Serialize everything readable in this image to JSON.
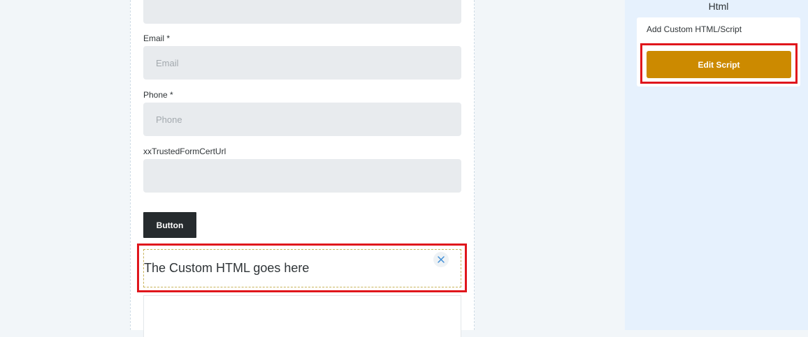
{
  "form": {
    "email_label": "Email *",
    "email_placeholder": "Email",
    "phone_label": "Phone *",
    "phone_placeholder": "Phone",
    "trusted_label": "xxTrustedFormCertUrl",
    "trusted_placeholder": "",
    "button_label": "Button",
    "custom_html_text": "The Custom HTML goes here"
  },
  "panel": {
    "title": "Html",
    "card_label": "Add Custom HTML/Script",
    "edit_button_label": "Edit Script"
  },
  "colors": {
    "highlight": "#e0161c",
    "edit_button": "#cc8a00",
    "form_button": "#262b2e",
    "panel_background": "#e6f1fd"
  },
  "icons": {
    "remove": "close-icon"
  }
}
